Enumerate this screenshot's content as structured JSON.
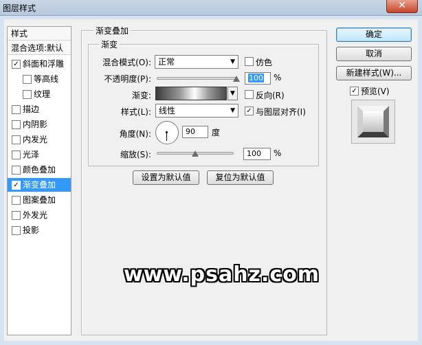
{
  "window": {
    "title": "图层样式",
    "close_glyph": "✕"
  },
  "styles_list": {
    "header": "样式",
    "blend_options": "混合选项:默认",
    "items": [
      {
        "label": "斜面和浮雕",
        "checked": true,
        "glyph": "✓"
      },
      {
        "label": "等高线",
        "checked": false,
        "glyph": ""
      },
      {
        "label": "纹理",
        "checked": false,
        "glyph": ""
      },
      {
        "label": "描边",
        "checked": false,
        "glyph": ""
      },
      {
        "label": "内阴影",
        "checked": false,
        "glyph": ""
      },
      {
        "label": "内发光",
        "checked": false,
        "glyph": ""
      },
      {
        "label": "光泽",
        "checked": false,
        "glyph": ""
      },
      {
        "label": "颜色叠加",
        "checked": false,
        "glyph": ""
      },
      {
        "label": "渐变叠加",
        "checked": true,
        "glyph": "✓"
      },
      {
        "label": "图案叠加",
        "checked": false,
        "glyph": ""
      },
      {
        "label": "外发光",
        "checked": false,
        "glyph": ""
      },
      {
        "label": "投影",
        "checked": false,
        "glyph": ""
      }
    ]
  },
  "gradient_overlay": {
    "group_title": "渐变叠加",
    "subgroup_title": "渐变",
    "blend_mode_label": "混合模式(O):",
    "blend_mode_value": "正常",
    "dither_label": "仿色",
    "opacity_label": "不透明度(P):",
    "opacity_value": "100",
    "percent": "%",
    "opacity_fraction": 1.0,
    "gradient_label": "渐变:",
    "reverse_label": "反向(R)",
    "style_label": "样式(L):",
    "style_value": "线性",
    "align_label": "与图层对齐(I)",
    "align_checked": true,
    "angle_label": "角度(N):",
    "angle_value": "90",
    "degree": "度",
    "scale_label": "缩放(S):",
    "scale_value": "100",
    "scale_fraction": 0.5,
    "make_default": "设置为默认值",
    "reset_default": "复位为默认值",
    "dropdown_glyph": "▼",
    "check_glyph": "✓"
  },
  "buttons": {
    "ok": "确定",
    "cancel": "取消",
    "new_style": "新建样式(W)...",
    "preview_label": "预览(V)",
    "preview_checked": true
  },
  "watermark": "www.psahz.com",
  "colors": {
    "selection": "#3399ff",
    "title_bar": "#c9d6e6",
    "close_button": "#c7442a"
  }
}
